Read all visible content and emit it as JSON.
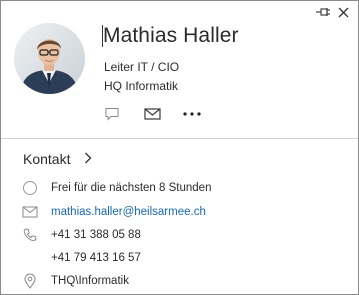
{
  "contact": {
    "name": "Mathias Haller",
    "title": "Leiter IT / CIO",
    "company": "HQ Informatik"
  },
  "section": {
    "label": "Kontakt"
  },
  "details": {
    "availability": "Frei für die nächsten 8 Stunden",
    "email": "mathias.haller@heilsarmee.ch",
    "phone1": "+41 31 388 05 88",
    "phone2": "+41 79 413 16 57",
    "location": "THQ\\Informatik"
  },
  "icons": {
    "pin": "pin-icon",
    "close": "close-icon",
    "chat": "chat-icon",
    "mail": "mail-icon",
    "more": "more-icon",
    "chevron": "chevron-right-icon",
    "status": "status-circle-icon",
    "phone": "phone-icon",
    "location": "location-icon"
  },
  "colors": {
    "link": "#1a67b5",
    "icon": "#7a7a7a",
    "divider": "#d2d2d2"
  }
}
